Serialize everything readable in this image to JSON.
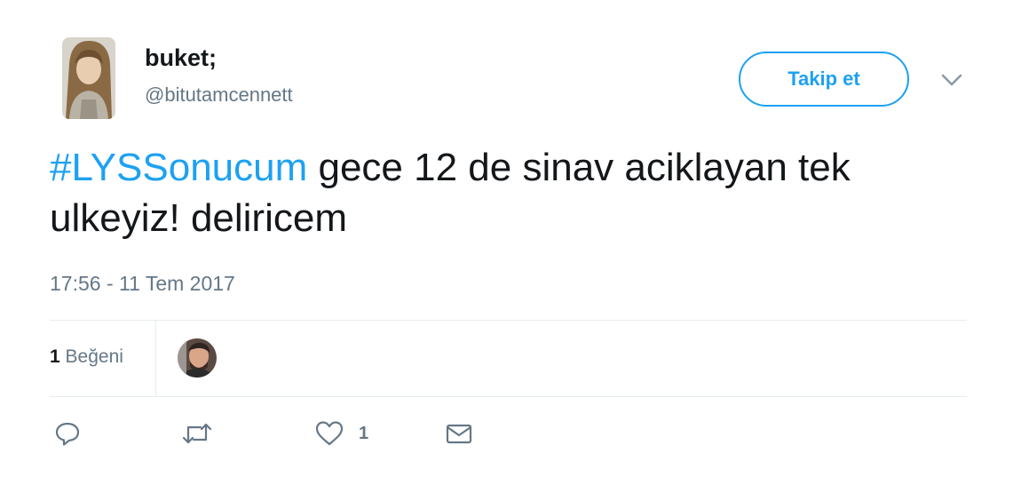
{
  "tweet": {
    "author": {
      "display_name": "buket;",
      "handle": "@bitutamcennett"
    },
    "follow_label": "Takip et",
    "text": {
      "hashtag": "#LYSSonucum",
      "body": " gece 12 de sinav aciklayan tek ulkeyiz! deliricem"
    },
    "timestamp": "17:56 - 11 Tem 2017",
    "stats": {
      "likes_number": "1",
      "likes_label": "Beğeni"
    },
    "actions": {
      "reply_icon": "reply-icon",
      "retweet_icon": "retweet-icon",
      "like_icon": "heart-icon",
      "like_count": "1",
      "message_icon": "envelope-icon"
    },
    "colors": {
      "accent": "#1da1f2",
      "text": "#14171a",
      "muted": "#657786",
      "divider": "#e6ecf0"
    }
  }
}
